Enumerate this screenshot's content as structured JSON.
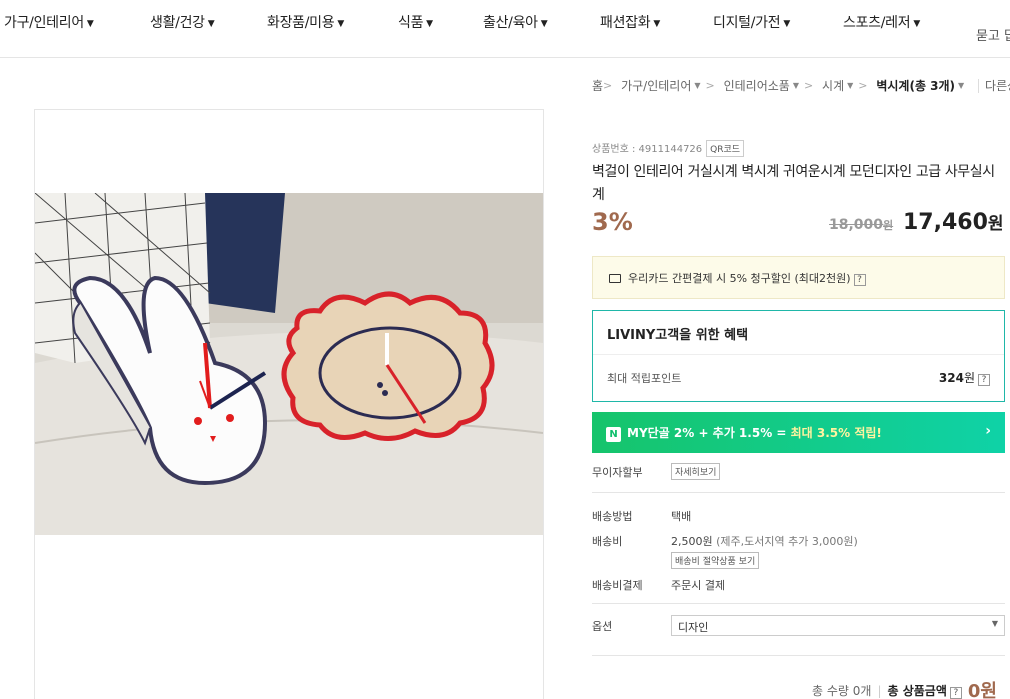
{
  "nav": {
    "categories": [
      {
        "label": "가구/인테리어"
      },
      {
        "label": "생활/건강"
      },
      {
        "label": "화장품/미용"
      },
      {
        "label": "식품"
      },
      {
        "label": "출산/육아"
      },
      {
        "label": "패션잡화"
      },
      {
        "label": "디지털/가전"
      },
      {
        "label": "스포츠/레저"
      }
    ],
    "ask_label": "묻고 답"
  },
  "breadcrumb": {
    "home": "홈",
    "level1": "가구/인테리어",
    "level2": "인테리어소품",
    "level3": "시계",
    "current": "벽시계",
    "count": "(총 3개)",
    "other": "다른상"
  },
  "product": {
    "number_label": "상품번호 : 4911144726",
    "qr_label": "QR코드",
    "title": "벽걸이 인테리어 거실시계 벽시계 귀여운시계 모던디자인 고급 사무실시계",
    "discount": "3%",
    "original_price": "18,000",
    "original_unit": "원",
    "sale_price": "17,460",
    "sale_unit": "원"
  },
  "card_promo": {
    "text": "우리카드 간편결제 시 5% 청구할인 (최대2천원)",
    "help": "?"
  },
  "benefit": {
    "title": "LIVINY고객을 위한 혜택",
    "row_label": "최대 적립포인트",
    "row_value": "324",
    "row_unit": "원",
    "help": "?"
  },
  "my_promo": {
    "logo": "N",
    "text_a": "MY단골 2% + 추가 1.5% = ",
    "text_b": "최대 3.5% 적립!",
    "arrow": "›"
  },
  "installment": {
    "label": "무이자할부",
    "button": "자세히보기"
  },
  "shipping": {
    "method_label": "배송방법",
    "method_value": "택배",
    "fee_label": "배송비",
    "fee_value": "2,500원",
    "fee_note": "(제주,도서지역 추가 3,000원)",
    "fee_button": "배송비 절약상품 보기",
    "pay_label": "배송비결제",
    "pay_value": "주문시 결제"
  },
  "option": {
    "label": "옵션",
    "selected": "디자인"
  },
  "total": {
    "qty_text": "총 수량 0개",
    "amount_label": "총 상품금액",
    "help": "?",
    "amount_value": "0원"
  },
  "colors": {
    "accent_brown": "#a0694e",
    "benefit_border": "#1fb7a8",
    "promo_green": "#16c46b"
  }
}
